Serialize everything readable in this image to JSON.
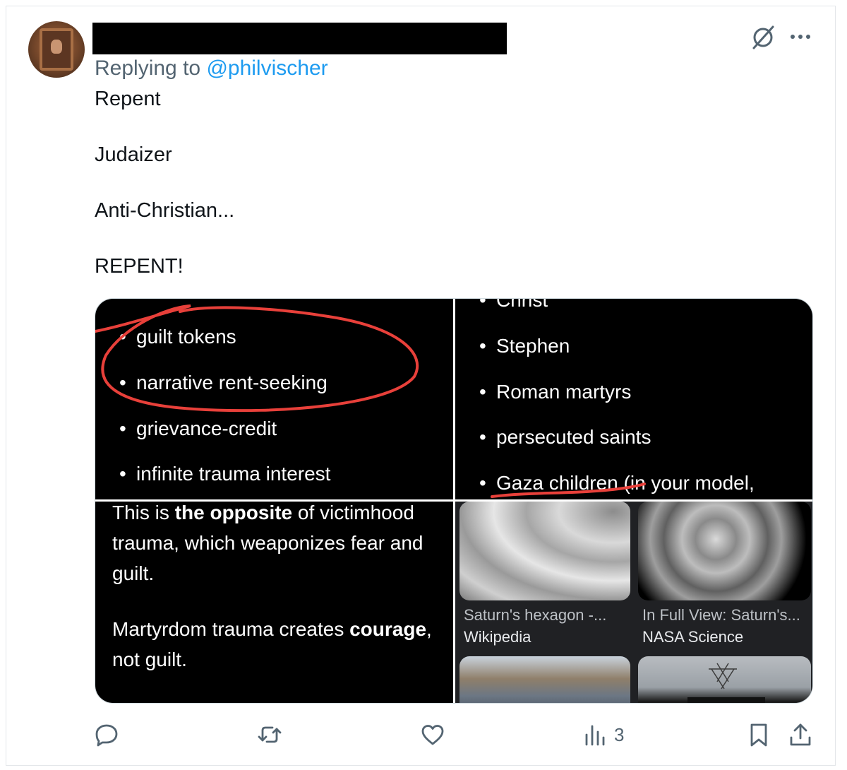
{
  "post": {
    "reply_prefix": "Replying to",
    "reply_handle": "@philvischer",
    "lines": [
      "Repent",
      "Judaizer",
      "Anti-Christian...",
      "REPENT!"
    ]
  },
  "image1": {
    "bullets": [
      "guilt tokens",
      "narrative rent-seeking",
      "grievance-credit",
      "infinite trauma interest"
    ]
  },
  "image2": {
    "bullets": [
      "Christ",
      "Stephen",
      "Roman martyrs",
      "persecuted saints",
      "Gaza children (in your model,"
    ]
  },
  "image3": {
    "p1_a": "This is ",
    "p1_b": "the opposite",
    "p1_c": " of victimhood trauma, which weaponizes fear and guilt.",
    "p2_a": "Martyrdom trauma creates ",
    "p2_b": "courage",
    "p2_c": ", not guilt."
  },
  "image4": {
    "results": [
      {
        "title": "Saturn's hexagon -...",
        "source": "Wikipedia"
      },
      {
        "title": "In Full View: Saturn's...",
        "source": "NASA Science"
      }
    ]
  },
  "actions": {
    "views": "3"
  },
  "colors": {
    "link": "#1d9bf0",
    "muted": "#536471",
    "annotation": "#e8403a"
  },
  "icons": [
    "grok-icon",
    "more-icon",
    "reply-icon",
    "retweet-icon",
    "like-icon",
    "views-icon",
    "bookmark-icon",
    "share-icon"
  ]
}
